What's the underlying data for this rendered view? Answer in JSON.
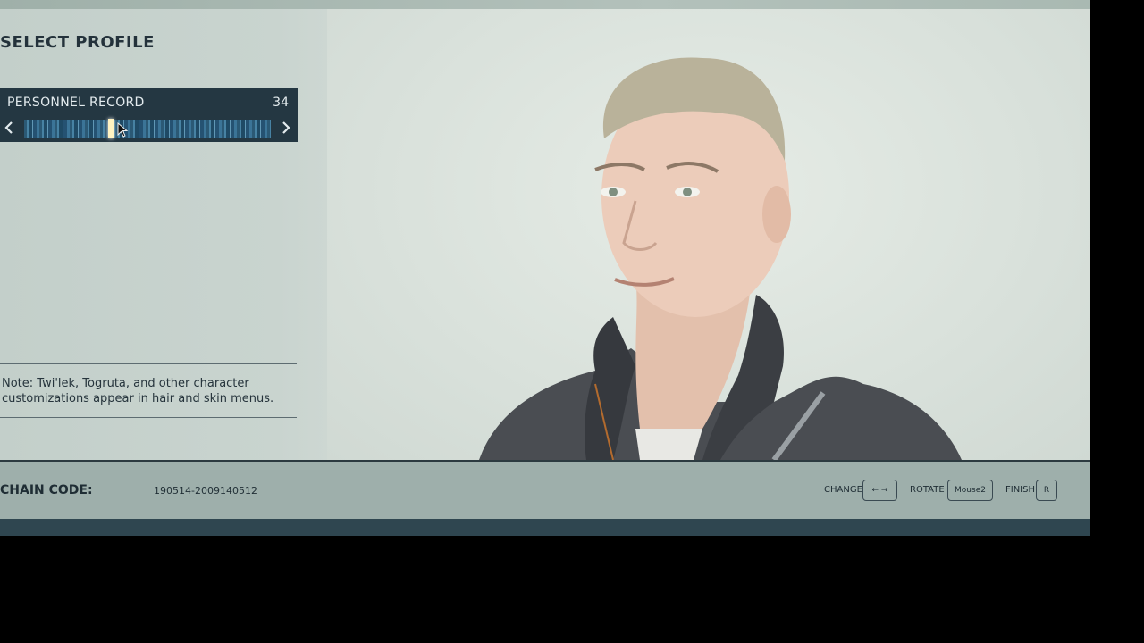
{
  "header": {
    "title": "SELECT PROFILE"
  },
  "record": {
    "label": "PERSONNEL RECORD",
    "count": "34",
    "prev_icon": "chevron-left-icon",
    "next_icon": "chevron-right-icon"
  },
  "note": {
    "text": "Note: Twi'lek, Togruta, and other character customizations appear in hair and skin menus."
  },
  "footer": {
    "chain_label": "CHAIN CODE:",
    "chain_value": "190514-2009140512",
    "hints": [
      {
        "label": "CHANGE",
        "key": "← →"
      },
      {
        "label": "ROTATE",
        "key": "Mouse2"
      },
      {
        "label": "FINISH",
        "key": "R"
      }
    ]
  },
  "colors": {
    "panel": "#243742",
    "accent": "#4d8fb4",
    "background": "#d3ddd7"
  }
}
